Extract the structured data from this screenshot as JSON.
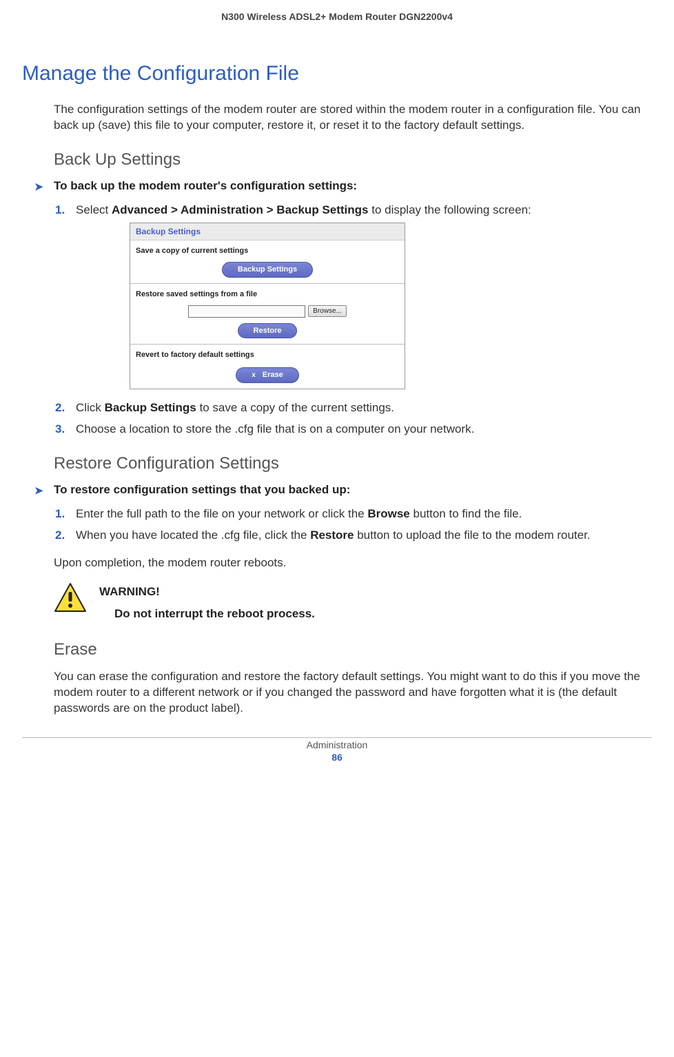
{
  "doc_header": "N300 Wireless ADSL2+ Modem Router DGN2200v4",
  "title": "Manage the Configuration File",
  "intro": "The configuration settings of the modem router are stored within the modem router in a configuration file. You can back up (save) this file to your computer, restore it, or reset it to the factory default settings.",
  "backup": {
    "heading": "Back Up Settings",
    "proc_title": "To back up the modem router's configuration settings:",
    "step1_pre": "Select ",
    "step1_bold": "Advanced > Administration > Backup Settings",
    "step1_post": " to display the following screen:",
    "step2_pre": "Click ",
    "step2_bold": "Backup Settings",
    "step2_post": " to save a copy of the current settings.",
    "step3": "Choose a location to store the .cfg file that is on a computer on your network.",
    "nums": {
      "n1": "1.",
      "n2": "2.",
      "n3": "3."
    }
  },
  "shot": {
    "title": "Backup Settings",
    "save_label": "Save a copy of current settings",
    "backup_btn": "Backup Settings",
    "restore_label": "Restore saved settings from a file",
    "browse_btn": "Browse...",
    "restore_btn": "Restore",
    "revert_label": "Revert to factory default settings",
    "erase_btn": "Erase",
    "erase_x": "x"
  },
  "restore": {
    "heading": "Restore Configuration Settings",
    "proc_title": "To restore configuration settings that you backed up:",
    "step1_pre": "Enter the full path to the file on your network or click the ",
    "step1_bold": "Browse",
    "step1_post": " button to find the file.",
    "step2_pre": "When you have located the .cfg file, click the ",
    "step2_bold": "Restore",
    "step2_post": " button to upload the file to the modem router.",
    "after": "Upon completion, the modem router reboots.",
    "nums": {
      "n1": "1.",
      "n2": "2."
    }
  },
  "warning": {
    "label": "WARNING!",
    "body": "Do not interrupt the reboot process."
  },
  "erase": {
    "heading": "Erase",
    "body": "You can erase the configuration and restore the factory default settings. You might want to do this if you move the modem router to a different network or if you changed the password and have forgotten what it is (the default passwords are on the product label)."
  },
  "footer": {
    "section": "Administration",
    "page": "86"
  }
}
